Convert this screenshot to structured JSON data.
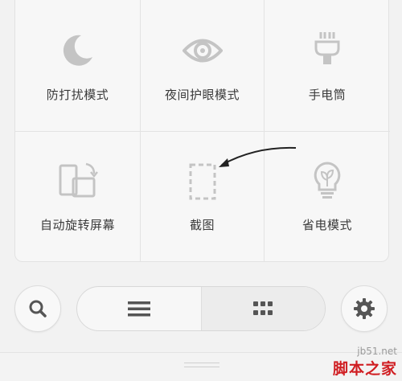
{
  "tiles": [
    {
      "label": "防打扰模式",
      "icon": "moon-icon"
    },
    {
      "label": "夜间护眼模式",
      "icon": "eye-icon"
    },
    {
      "label": "手电筒",
      "icon": "flashlight-icon"
    },
    {
      "label": "自动旋转屏幕",
      "icon": "rotate-screen-icon"
    },
    {
      "label": "截图",
      "icon": "screenshot-icon"
    },
    {
      "label": "省电模式",
      "icon": "lightbulb-icon"
    }
  ],
  "bottom_controls": {
    "search_icon": "search-icon",
    "list_view_icon": "list-icon",
    "grid_view_icon": "grid-icon",
    "settings_icon": "gear-icon",
    "active_view": "grid"
  },
  "watermark": {
    "site": "jb51.net",
    "name": "脚本之家"
  },
  "colors": {
    "icon_gray": "#c4c4c4",
    "label_text": "#3a3a3a",
    "watermark_red": "#d01e22"
  }
}
